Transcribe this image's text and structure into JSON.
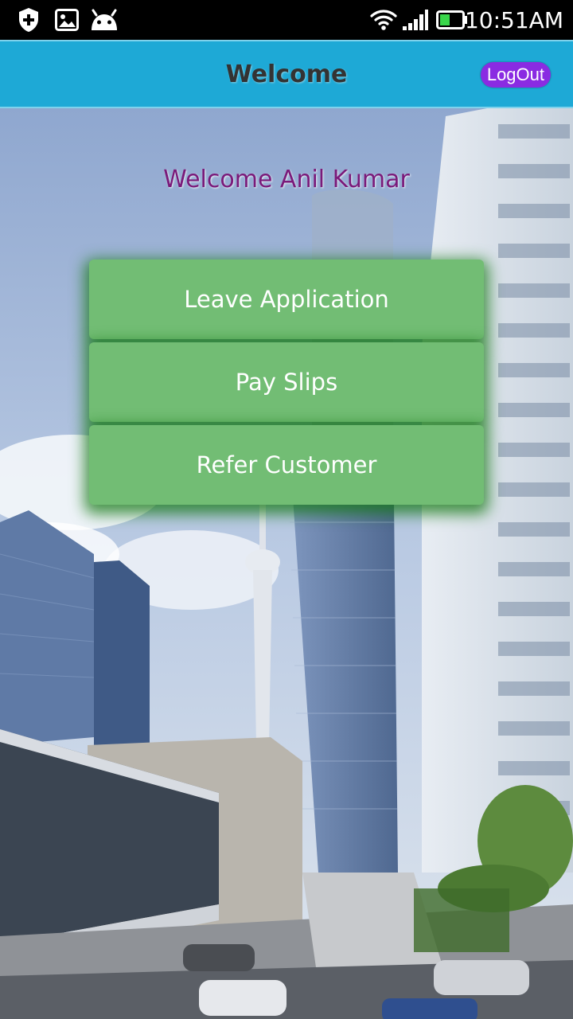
{
  "status_bar": {
    "time": "10:51AM",
    "icons": [
      "shield-icon",
      "gallery-icon",
      "android-icon",
      "wifi-icon",
      "signal-icon",
      "battery-icon"
    ]
  },
  "app_bar": {
    "title": "Welcome",
    "logout_label": "LogOut",
    "color": "#1ea9d6",
    "logout_color": "#8a2be2"
  },
  "main": {
    "greeting": "Welcome Anil Kumar",
    "greeting_color": "#7a1a7a",
    "menu": [
      {
        "label": "Leave Application"
      },
      {
        "label": "Pay Slips"
      },
      {
        "label": "Refer Customer"
      }
    ],
    "button_color": "#72bd74"
  }
}
